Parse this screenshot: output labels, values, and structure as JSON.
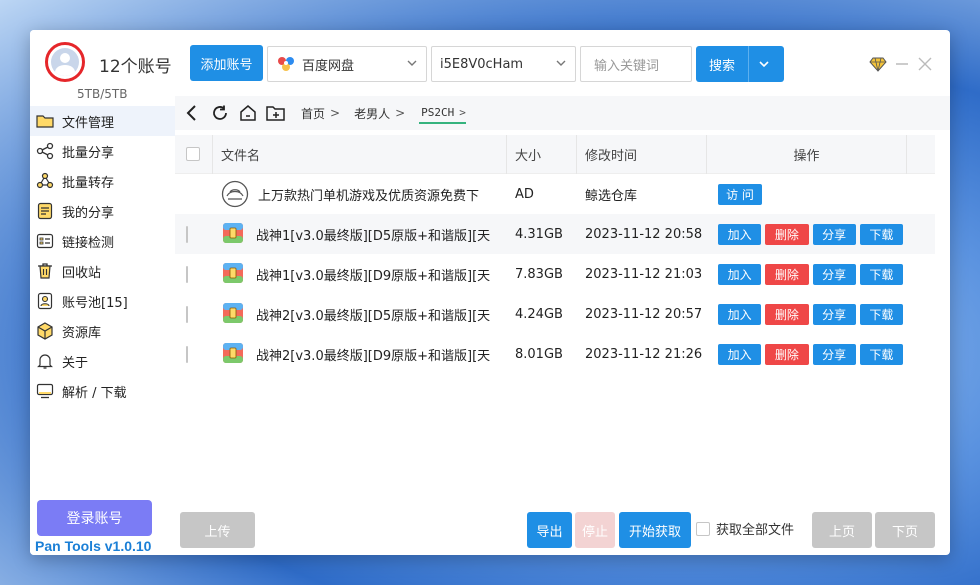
{
  "account": {
    "title": "12个账号",
    "quota": "5TB/5TB"
  },
  "toolbar": {
    "add_account": "添加账号",
    "pan_select": "百度网盘",
    "account_select": "i5E8V0cHam",
    "search_placeholder": "输入关键词",
    "search_button": "搜索"
  },
  "sidebar": {
    "items": [
      {
        "label": "文件管理",
        "icon": "folder-icon"
      },
      {
        "label": "批量分享",
        "icon": "share-icon"
      },
      {
        "label": "批量转存",
        "icon": "transfer-icon"
      },
      {
        "label": "我的分享",
        "icon": "my-share-icon"
      },
      {
        "label": "链接检测",
        "icon": "link-check-icon"
      },
      {
        "label": "回收站",
        "icon": "trash-icon"
      },
      {
        "label": "账号池[15]",
        "icon": "account-pool-icon"
      },
      {
        "label": "资源库",
        "icon": "cube-icon"
      },
      {
        "label": "关于",
        "icon": "bell-icon"
      },
      {
        "label": "解析 / 下载",
        "icon": "monitor-icon"
      }
    ],
    "login_button": "登录账号",
    "version": "Pan Tools v1.0.10"
  },
  "breadcrumb": {
    "items": [
      "首页",
      "老男人"
    ],
    "current": "PS2CH"
  },
  "table": {
    "headers": {
      "name": "文件名",
      "size": "大小",
      "time": "修改时间",
      "actions": "操作"
    },
    "ad_row": {
      "name": "上万款热门单机游戏及优质资源免费下",
      "size": "AD",
      "time": "鲸选仓库",
      "action": "访 问"
    },
    "rows": [
      {
        "name": "战神1[v3.0最终版][D5原版+和谐版][天",
        "size": "4.31GB",
        "time": "2023-11-12 20:58"
      },
      {
        "name": "战神1[v3.0最终版][D9原版+和谐版][天",
        "size": "7.83GB",
        "time": "2023-11-12 21:03"
      },
      {
        "name": "战神2[v3.0最终版][D5原版+和谐版][天",
        "size": "4.24GB",
        "time": "2023-11-12 20:57"
      },
      {
        "name": "战神2[v3.0最终版][D9原版+和谐版][天",
        "size": "8.01GB",
        "time": "2023-11-12 21:26"
      }
    ],
    "row_actions": {
      "add": "加入",
      "delete": "删除",
      "share": "分享",
      "download": "下载"
    }
  },
  "footer": {
    "upload": "上传",
    "export": "导出",
    "stop": "停止",
    "start_fetch": "开始获取",
    "fetch_all": "获取全部文件",
    "prev": "上页",
    "next": "下页"
  }
}
